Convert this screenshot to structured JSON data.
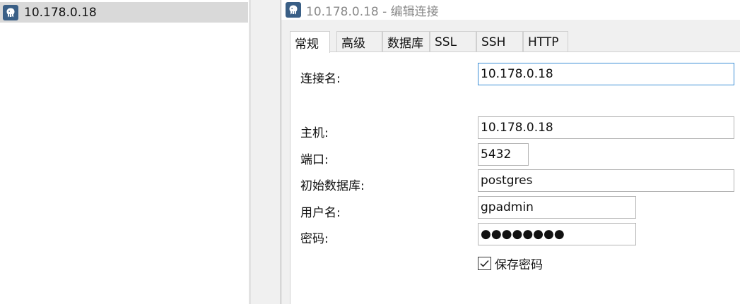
{
  "tree": {
    "connection_label": "10.178.0.18"
  },
  "dialog": {
    "title": "10.178.0.18 - 编辑连接",
    "tabs": [
      "常规",
      "高级",
      "数据库",
      "SSL",
      "SSH",
      "HTTP"
    ],
    "active_tab": "常规",
    "fields": {
      "connection_name": {
        "label": "连接名:",
        "value": "10.178.0.18"
      },
      "host": {
        "label": "主机:",
        "value": "10.178.0.18"
      },
      "port": {
        "label": "端口:",
        "value": "5432"
      },
      "initial_db": {
        "label": "初始数据库:",
        "value": "postgres"
      },
      "username": {
        "label": "用户名:",
        "value": "gpadmin"
      },
      "password": {
        "label": "密码:",
        "value": "●●●●●●●●"
      }
    },
    "save_password": {
      "label": "保存密码",
      "checked": true
    }
  },
  "colors": {
    "selection": "#d9d9d9",
    "dialog_bg": "#f0f0f0",
    "focus_border": "#3c8fd6",
    "title_text": "#8a8a8a",
    "pg_icon": "#3a5f86"
  },
  "icons": {
    "app": "postgresql-elephant-icon",
    "check": "checkmark-icon"
  }
}
